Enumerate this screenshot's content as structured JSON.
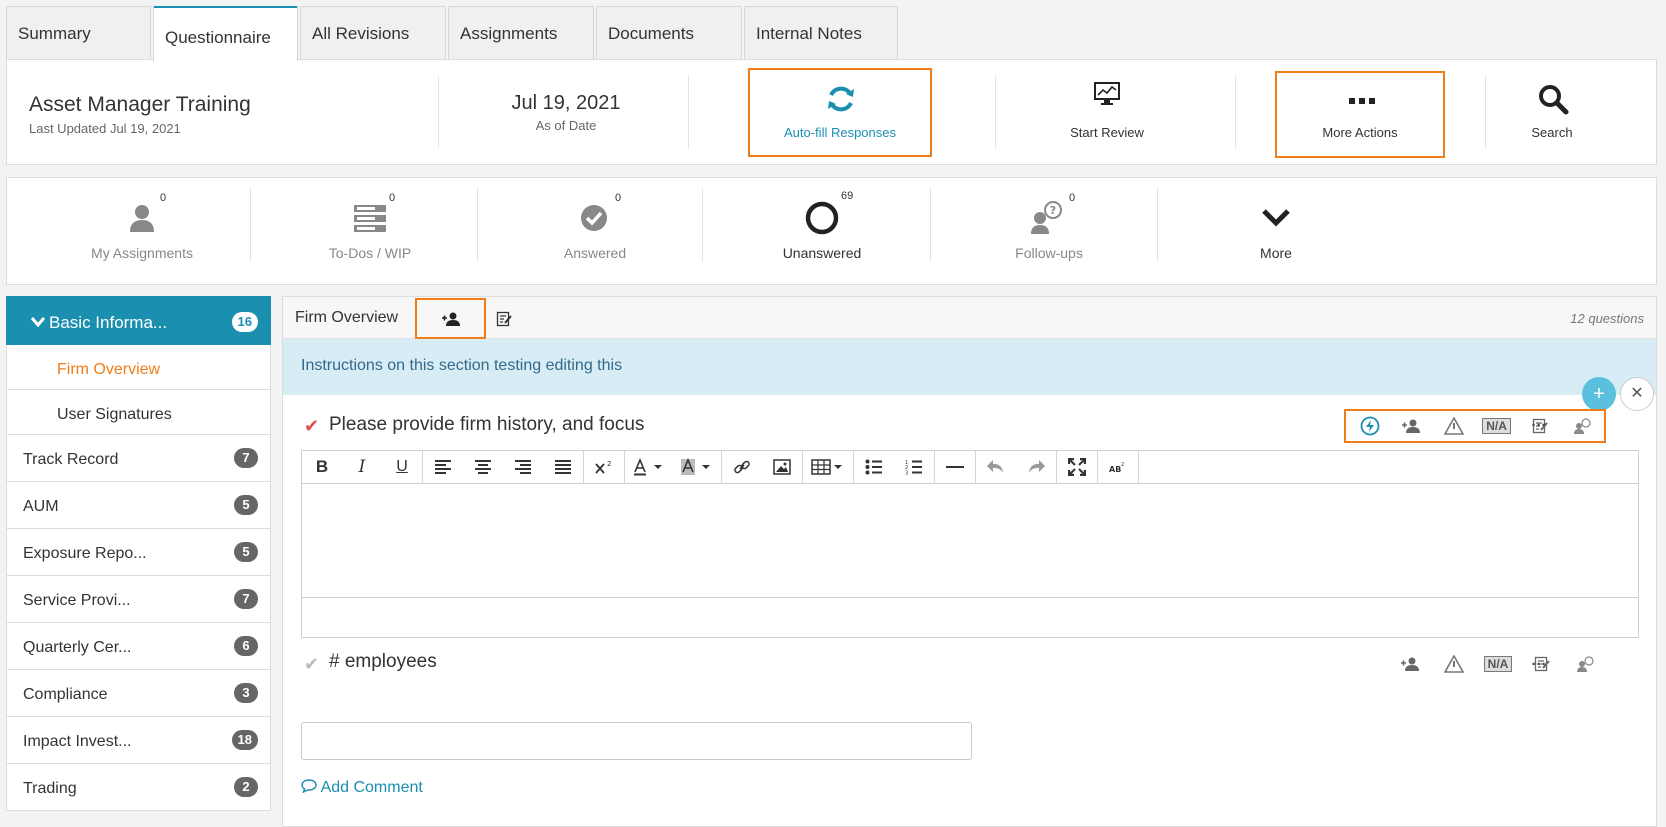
{
  "tabs": [
    {
      "label": "Summary"
    },
    {
      "label": "Questionnaire"
    },
    {
      "label": "All Revisions"
    },
    {
      "label": "Assignments"
    },
    {
      "label": "Documents"
    },
    {
      "label": "Internal Notes"
    }
  ],
  "header": {
    "title": "Asset Manager Training",
    "last_updated": "Last Updated Jul 19, 2021",
    "date": "Jul 19, 2021",
    "date_label": "As of Date",
    "autofill_label": "Auto-fill Responses",
    "start_review_label": "Start Review",
    "more_actions_label": "More Actions",
    "search_label": "Search"
  },
  "stats": [
    {
      "label": "My Assignments",
      "count": "0"
    },
    {
      "label": "To-Dos / WIP",
      "count": "0"
    },
    {
      "label": "Answered",
      "count": "0"
    },
    {
      "label": "Unanswered",
      "count": "69"
    },
    {
      "label": "Follow-ups",
      "count": "0"
    },
    {
      "label": "More",
      "count": ""
    }
  ],
  "sidebar": {
    "items": [
      {
        "label": "Basic Informa...",
        "count": "16"
      },
      {
        "label": "Firm Overview"
      },
      {
        "label": "User Signatures"
      },
      {
        "label": "Track Record",
        "count": "7"
      },
      {
        "label": "AUM",
        "count": "5"
      },
      {
        "label": "Exposure Repo...",
        "count": "5"
      },
      {
        "label": "Service Provi...",
        "count": "7"
      },
      {
        "label": "Quarterly Cer...",
        "count": "6"
      },
      {
        "label": "Compliance",
        "count": "3"
      },
      {
        "label": "Impact Invest...",
        "count": "18"
      },
      {
        "label": "Trading",
        "count": "2"
      }
    ]
  },
  "section": {
    "title": "Firm Overview",
    "question_count": "12 questions",
    "instructions": "Instructions on this section testing editing this"
  },
  "questions": [
    {
      "title": "Please provide firm history, and focus"
    },
    {
      "title": "# employees"
    }
  ],
  "na_label": "N/A",
  "add_comment_label": "Add Comment",
  "colors": {
    "accent": "#1b8fb0",
    "highlight": "#ef7d1a",
    "check_red": "#d9534f"
  }
}
